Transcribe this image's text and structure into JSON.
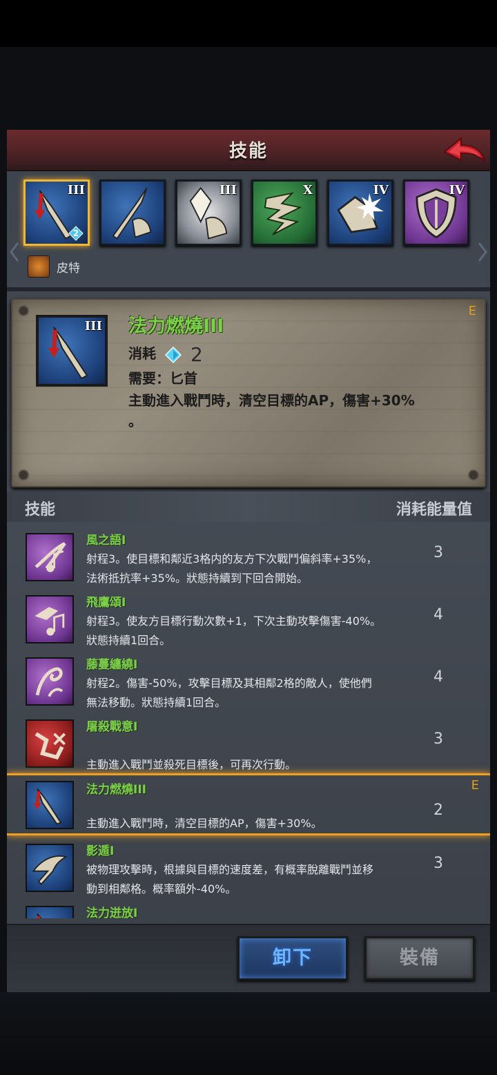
{
  "header": {
    "title": "技能"
  },
  "equipped_skills": [
    {
      "rank": "III",
      "color": "blue",
      "icon": "dagger-down-arrow-icon",
      "badge": "2",
      "selected": true
    },
    {
      "rank": "",
      "color": "blue",
      "icon": "spear-arm-icon",
      "badge": "",
      "selected": false
    },
    {
      "rank": "III",
      "color": "blue",
      "icon": "crystal-arm-icon",
      "badge": "",
      "selected": false
    },
    {
      "rank": "X",
      "color": "green",
      "icon": "wind-slash-icon",
      "badge": "",
      "selected": false
    },
    {
      "rank": "IV",
      "color": "blue",
      "icon": "burst-fist-icon",
      "badge": "",
      "selected": false
    },
    {
      "rank": "IV",
      "color": "purple",
      "icon": "shield-icon",
      "badge": "",
      "selected": false
    }
  ],
  "owner": {
    "name": "皮特"
  },
  "detail": {
    "name": "法力燃燒III",
    "tag": "E",
    "rank": "III",
    "cost_label": "消耗",
    "cost_value": "2",
    "requirement": "需要：匕首",
    "description_line1": "主動進入戰鬥時，清空目標的AP，傷害+30%",
    "description_line2": "。"
  },
  "list": {
    "header_left": "技能",
    "header_right": "消耗能量值",
    "items": [
      {
        "name": "風之語I",
        "desc1": "射程3。使目標和鄰近3格内的友方下次戰鬥偏斜率+35%，",
        "desc2": "法術抵抗率+35%。狀態持續到下回合開始。",
        "cost": "3",
        "color": "purple",
        "icon": "music-note-wind-icon"
      },
      {
        "name": "飛鷹頌I",
        "desc1": "射程3。使友方目標行動次數+1，下次主動攻擊傷害-40%。",
        "desc2": "狀態持續1回合。",
        "cost": "4",
        "color": "purple",
        "icon": "music-note-eagle-icon"
      },
      {
        "name": "藤蔓纏繞I",
        "desc1": "射程2。傷害-50%，攻擊目標及其相鄰2格的敵人，使他們",
        "desc2": "無法移動。狀態持續1回合。",
        "cost": "4",
        "color": "purple",
        "icon": "vine-grip-icon"
      },
      {
        "name": "屠殺戰意I",
        "desc1": "",
        "desc2": "主動進入戰鬥並殺死目標後，可再次行動。",
        "cost": "3",
        "color": "red",
        "icon": "slain-foe-icon"
      },
      {
        "name": "法力燃燒III",
        "desc1": "",
        "desc2": "主動進入戰鬥時，清空目標的AP，傷害+30%。",
        "cost": "2",
        "color": "blue",
        "icon": "dagger-down-arrow-icon",
        "tag": "E"
      },
      {
        "name": "影遁I",
        "desc1": "被物理攻擊時，根據與目標的速度差，有概率脫離戰鬥並移",
        "desc2": "動到相鄰格。概率額外-40%。",
        "cost": "3",
        "color": "blue",
        "icon": "shadow-step-icon"
      },
      {
        "name": "法力迸放I",
        "desc1": "",
        "desc2": "",
        "cost": "",
        "color": "blue",
        "icon": "dagger-down-arrow-icon"
      }
    ]
  },
  "footer": {
    "unequip_label": "卸下",
    "equip_label": "裝備"
  }
}
